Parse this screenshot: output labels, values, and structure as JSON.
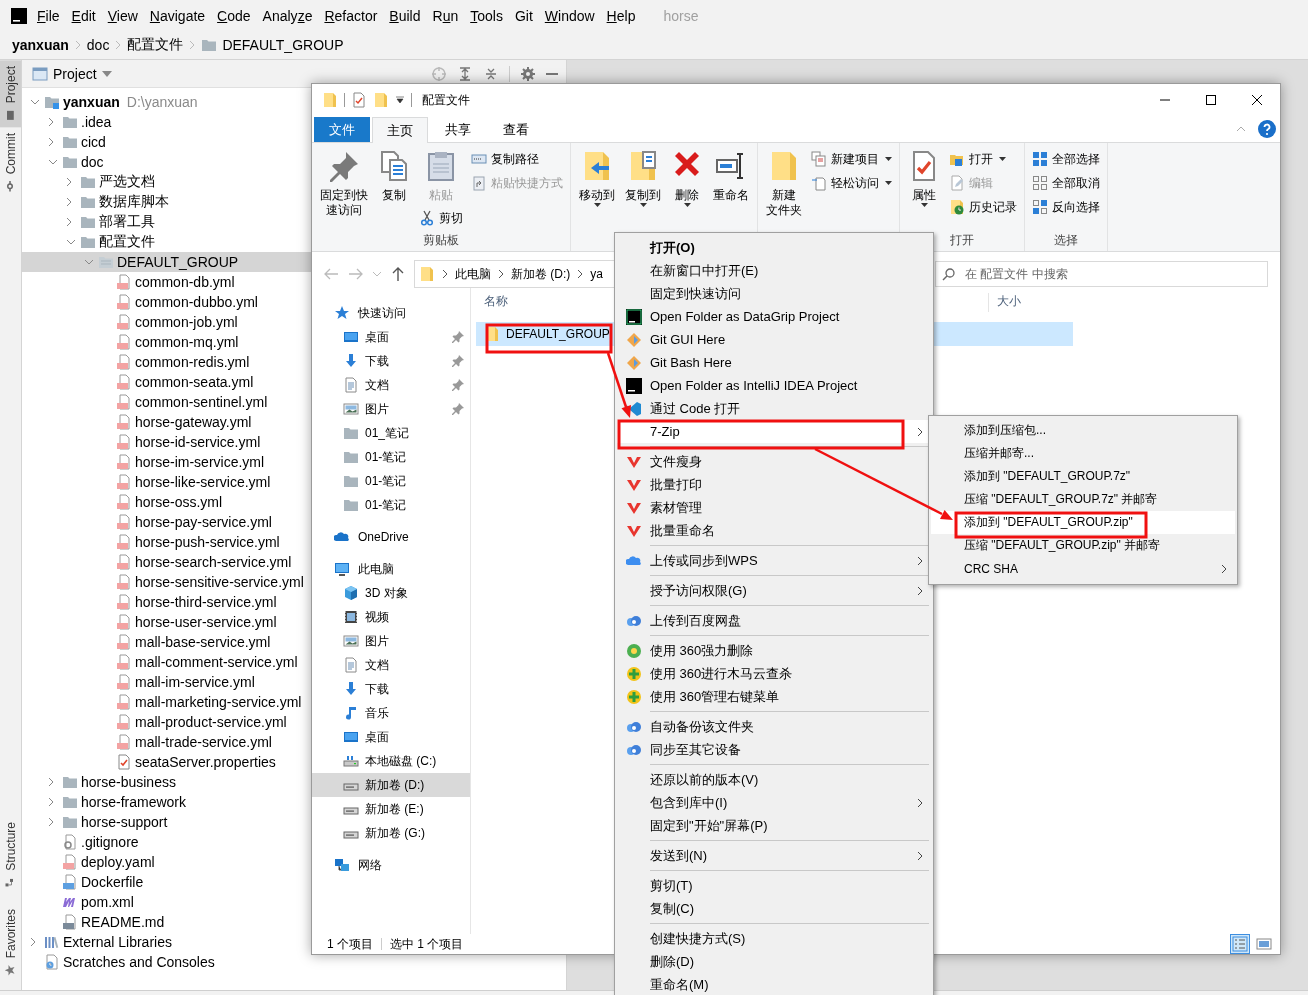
{
  "ide_menu": [
    {
      "key": "F",
      "post": "ile"
    },
    {
      "key": "E",
      "post": "dit"
    },
    {
      "key": "V",
      "post": "iew"
    },
    {
      "key": "N",
      "post": "avigate"
    },
    {
      "key": "C",
      "post": "ode"
    },
    {
      "pre": "Analy",
      "key": "z",
      "post": "e"
    },
    {
      "key": "R",
      "post": "efactor"
    },
    {
      "key": "B",
      "post": "uild"
    },
    {
      "pre": "R",
      "key": "u",
      "post": "n"
    },
    {
      "key": "T",
      "post": "ools"
    },
    {
      "pre": "Git"
    },
    {
      "key": "W",
      "post": "indow"
    },
    {
      "key": "H",
      "post": "elp"
    }
  ],
  "project_title": "horse",
  "breadcrumb": [
    {
      "label": "yanxuan",
      "kind": "root"
    },
    {
      "label": "doc",
      "kind": "plain"
    },
    {
      "label": "配置文件",
      "kind": "plain"
    },
    {
      "label": "DEFAULT_GROUP",
      "kind": "icon"
    }
  ],
  "tool_windows": [
    {
      "label": "Project",
      "kind": "top",
      "selected": true
    },
    {
      "label": "Commit",
      "kind": "top",
      "selected": false
    },
    {
      "label": "Structure",
      "kind": "bottom",
      "selected": false
    },
    {
      "label": "Favorites",
      "kind": "bottom",
      "selected": false
    }
  ],
  "project_panel": {
    "title": "Project",
    "tree": [
      {
        "label": "yanxuan",
        "kind": "module",
        "path": "D:\\yanxuan",
        "expanded": true,
        "selected": false,
        "children": [
          {
            "label": ".idea",
            "kind": "folder",
            "expanded": false,
            "selected": false
          },
          {
            "label": "cicd",
            "kind": "folder",
            "expanded": false,
            "selected": false
          },
          {
            "label": "doc",
            "kind": "folder",
            "expanded": true,
            "selected": false,
            "children": [
              {
                "label": "严选文档",
                "kind": "folder",
                "expanded": false,
                "selected": false
              },
              {
                "label": "数据库脚本",
                "kind": "folder",
                "expanded": false,
                "selected": false
              },
              {
                "label": "部署工具",
                "kind": "folder",
                "expanded": false,
                "selected": false
              },
              {
                "label": "配置文件",
                "kind": "folder",
                "expanded": true,
                "selected": false,
                "children": [
                  {
                    "label": "DEFAULT_GROUP",
                    "kind": "package",
                    "expanded": true,
                    "selected": true,
                    "children": [
                      {
                        "label": "common-db.yml",
                        "kind": "yml",
                        "selected": false
                      },
                      {
                        "label": "common-dubbo.yml",
                        "kind": "yml",
                        "selected": false
                      },
                      {
                        "label": "common-job.yml",
                        "kind": "yml",
                        "selected": false
                      },
                      {
                        "label": "common-mq.yml",
                        "kind": "yml",
                        "selected": false
                      },
                      {
                        "label": "common-redis.yml",
                        "kind": "yml",
                        "selected": false
                      },
                      {
                        "label": "common-seata.yml",
                        "kind": "yml",
                        "selected": false
                      },
                      {
                        "label": "common-sentinel.yml",
                        "kind": "yml",
                        "selected": false
                      },
                      {
                        "label": "horse-gateway.yml",
                        "kind": "yml",
                        "selected": false
                      },
                      {
                        "label": "horse-id-service.yml",
                        "kind": "yml",
                        "selected": false
                      },
                      {
                        "label": "horse-im-service.yml",
                        "kind": "yml",
                        "selected": false
                      },
                      {
                        "label": "horse-like-service.yml",
                        "kind": "yml",
                        "selected": false
                      },
                      {
                        "label": "horse-oss.yml",
                        "kind": "yml",
                        "selected": false
                      },
                      {
                        "label": "horse-pay-service.yml",
                        "kind": "yml",
                        "selected": false
                      },
                      {
                        "label": "horse-push-service.yml",
                        "kind": "yml",
                        "selected": false
                      },
                      {
                        "label": "horse-search-service.yml",
                        "kind": "yml",
                        "selected": false
                      },
                      {
                        "label": "horse-sensitive-service.yml",
                        "kind": "yml",
                        "selected": false
                      },
                      {
                        "label": "horse-third-service.yml",
                        "kind": "yml",
                        "selected": false
                      },
                      {
                        "label": "horse-user-service.yml",
                        "kind": "yml",
                        "selected": false
                      },
                      {
                        "label": "mall-base-service.yml",
                        "kind": "yml",
                        "selected": false
                      },
                      {
                        "label": "mall-comment-service.yml",
                        "kind": "yml",
                        "selected": false
                      },
                      {
                        "label": "mall-im-service.yml",
                        "kind": "yml",
                        "selected": false
                      },
                      {
                        "label": "mall-marketing-service.yml",
                        "kind": "yml",
                        "selected": false
                      },
                      {
                        "label": "mall-product-service.yml",
                        "kind": "yml",
                        "selected": false
                      },
                      {
                        "label": "mall-trade-service.yml",
                        "kind": "yml",
                        "selected": false
                      },
                      {
                        "label": "seataServer.properties",
                        "kind": "properties",
                        "selected": false
                      }
                    ]
                  }
                ]
              }
            ]
          },
          {
            "label": "horse-business",
            "kind": "folder",
            "expanded": false,
            "selected": false
          },
          {
            "label": "horse-framework",
            "kind": "folder",
            "expanded": false,
            "selected": false
          },
          {
            "label": "horse-support",
            "kind": "folder",
            "expanded": false,
            "selected": false
          },
          {
            "label": ".gitignore",
            "kind": "ignore",
            "selected": false
          },
          {
            "label": "deploy.yaml",
            "kind": "yml",
            "selected": false
          },
          {
            "label": "Dockerfile",
            "kind": "docker",
            "selected": false
          },
          {
            "label": "pom.xml",
            "kind": "maven",
            "selected": false
          },
          {
            "label": "README.md",
            "kind": "markdown",
            "selected": false
          }
        ]
      },
      {
        "label": "External Libraries",
        "kind": "libraries",
        "expanded": false,
        "selected": false
      },
      {
        "label": "Scratches and Consoles",
        "kind": "scratches",
        "selected": false
      }
    ]
  },
  "explorer": {
    "title": "配置文件",
    "ribbon_tabs": [
      {
        "label": "文件",
        "kind": "file",
        "selected": false
      },
      {
        "label": "主页",
        "kind": "tab",
        "selected": true
      },
      {
        "label": "共享",
        "kind": "tab",
        "selected": false
      },
      {
        "label": "查看",
        "kind": "tab",
        "selected": false
      }
    ],
    "ribbon_groups": [
      {
        "label": "剪贴板",
        "columns": [
          [
            {
              "lines": [
                "固定到快",
                "速访问"
              ],
              "kind": "large",
              "dropdown": false,
              "disabled": false
            }
          ],
          [
            {
              "label": "复制",
              "kind": "large",
              "dropdown": false,
              "disabled": false
            }
          ],
          [
            {
              "label": "粘贴",
              "kind": "large",
              "dropdown": false,
              "disabled": true
            },
            {
              "label": "剪切",
              "kind": "small",
              "dropdown": false,
              "disabled": false
            }
          ],
          [
            {
              "label": "复制路径",
              "kind": "small",
              "dropdown": false,
              "disabled": false
            },
            {
              "label": "粘贴快捷方式",
              "kind": "small",
              "dropdown": false,
              "disabled": true
            }
          ]
        ]
      },
      {
        "columns": [
          [
            {
              "label": "移动到",
              "kind": "large",
              "dropdown": true,
              "disabled": false
            }
          ],
          [
            {
              "label": "复制到",
              "kind": "large",
              "dropdown": true,
              "disabled": false
            }
          ],
          [
            {
              "label": "删除",
              "kind": "large",
              "dropdown": true,
              "disabled": false
            }
          ],
          [
            {
              "label": "重命名",
              "kind": "large",
              "dropdown": false,
              "disabled": false
            }
          ]
        ]
      },
      {
        "columns": [
          [
            {
              "lines": [
                "新建",
                "文件夹"
              ],
              "kind": "large",
              "dropdown": false,
              "disabled": false
            }
          ],
          [
            {
              "label": "新建项目",
              "kind": "small",
              "dropdown": true,
              "disabled": false
            },
            {
              "label": "轻松访问",
              "kind": "small",
              "dropdown": true,
              "disabled": false
            }
          ]
        ]
      },
      {
        "label": "打开",
        "columns": [
          [
            {
              "label": "属性",
              "kind": "large",
              "dropdown": true,
              "disabled": false
            }
          ],
          [
            {
              "label": "打开",
              "kind": "small",
              "dropdown": true,
              "disabled": false
            },
            {
              "label": "编辑",
              "kind": "small",
              "dropdown": false,
              "disabled": true
            },
            {
              "label": "历史记录",
              "kind": "small",
              "dropdown": false,
              "disabled": false
            }
          ]
        ]
      },
      {
        "label": "选择",
        "columns": [
          [
            {
              "label": "全部选择",
              "kind": "small",
              "dropdown": false,
              "disabled": false
            },
            {
              "label": "全部取消",
              "kind": "small",
              "dropdown": false,
              "disabled": false
            },
            {
              "label": "反向选择",
              "kind": "small",
              "dropdown": false,
              "disabled": false
            }
          ]
        ]
      }
    ],
    "address": [
      "此电脑",
      "新加卷 (D:)",
      "ya"
    ],
    "search": {
      "placeholder": "在 配置文件 中搜索"
    },
    "nav": [
      {
        "label": "快速访问",
        "kind": "star",
        "selected": false,
        "children": [
          {
            "label": "桌面",
            "kind": "desktop",
            "pinned": true,
            "selected": false
          },
          {
            "label": "下载",
            "kind": "download",
            "pinned": true,
            "selected": false
          },
          {
            "label": "文档",
            "kind": "document",
            "pinned": true,
            "selected": false
          },
          {
            "label": "图片",
            "kind": "picture",
            "pinned": true,
            "selected": false
          },
          {
            "label": "01_笔记",
            "kind": "folder",
            "pinned": false,
            "selected": false
          },
          {
            "label": "01-笔记",
            "kind": "folder",
            "pinned": false,
            "selected": false
          },
          {
            "label": "01-笔记",
            "kind": "folder",
            "pinned": false,
            "selected": false
          },
          {
            "label": "01-笔记",
            "kind": "folder",
            "pinned": false,
            "selected": false
          }
        ]
      },
      {
        "label": "OneDrive",
        "kind": "onedrive",
        "selected": false
      },
      {
        "label": "此电脑",
        "kind": "pc",
        "selected": false,
        "children": [
          {
            "label": "3D 对象",
            "kind": "cube",
            "selected": false
          },
          {
            "label": "视频",
            "kind": "video",
            "selected": false
          },
          {
            "label": "图片",
            "kind": "picture",
            "selected": false
          },
          {
            "label": "文档",
            "kind": "document",
            "selected": false
          },
          {
            "label": "下载",
            "kind": "download",
            "selected": false
          },
          {
            "label": "音乐",
            "kind": "music",
            "selected": false
          },
          {
            "label": "桌面",
            "kind": "desktop",
            "selected": false
          },
          {
            "label": "本地磁盘 (C:)",
            "kind": "drive-c",
            "selected": false
          },
          {
            "label": "新加卷 (D:)",
            "kind": "drive",
            "selected": true
          },
          {
            "label": "新加卷 (E:)",
            "kind": "drive",
            "selected": false
          },
          {
            "label": "新加卷 (G:)",
            "kind": "drive",
            "selected": false
          }
        ]
      },
      {
        "label": "网络",
        "kind": "network",
        "selected": false
      }
    ],
    "columns": [
      "名称",
      "大小"
    ],
    "items": [
      {
        "name": "DEFAULT_GROUP",
        "selected": true
      }
    ],
    "status": [
      "1 个项目",
      "选中 1 个项目"
    ],
    "view_modes": [
      {
        "kind": "details",
        "selected": true
      },
      {
        "kind": "large-icons",
        "selected": false
      }
    ]
  },
  "context_menu": {
    "items": [
      {
        "kind": "default",
        "label": "打开(O)",
        "submenu": false,
        "selected": false
      },
      {
        "kind": "plain",
        "label": "在新窗口中打开(E)",
        "submenu": false,
        "selected": false
      },
      {
        "kind": "plain",
        "label": "固定到快速访问",
        "submenu": false,
        "selected": false
      },
      {
        "kind": "datagrip",
        "label": "Open Folder as DataGrip Project",
        "submenu": false,
        "selected": false
      },
      {
        "kind": "git",
        "label": "Git GUI Here",
        "submenu": false,
        "selected": false
      },
      {
        "kind": "git",
        "label": "Git Bash Here",
        "submenu": false,
        "selected": false
      },
      {
        "kind": "idea",
        "label": "Open Folder as IntelliJ IDEA Project",
        "submenu": false,
        "selected": false
      },
      {
        "kind": "vscode",
        "label": "通过 Code 打开",
        "submenu": false,
        "selected": false
      },
      {
        "kind": "plain",
        "label": "7-Zip",
        "submenu": true,
        "selected": true
      },
      {
        "kind": "separator"
      },
      {
        "kind": "wps",
        "label": "文件瘦身",
        "submenu": false,
        "selected": false
      },
      {
        "kind": "wps",
        "label": "批量打印",
        "submenu": false,
        "selected": false
      },
      {
        "kind": "wps",
        "label": "素材管理",
        "submenu": false,
        "selected": false
      },
      {
        "kind": "wps",
        "label": "批量重命名",
        "submenu": false,
        "selected": false
      },
      {
        "kind": "separator"
      },
      {
        "kind": "wps-cloud",
        "label": "上传或同步到WPS",
        "submenu": true,
        "selected": false
      },
      {
        "kind": "separator"
      },
      {
        "kind": "plain",
        "label": "授予访问权限(G)",
        "submenu": true,
        "selected": false
      },
      {
        "kind": "separator"
      },
      {
        "kind": "baidu",
        "label": "上传到百度网盘",
        "submenu": false,
        "selected": false
      },
      {
        "kind": "separator"
      },
      {
        "kind": "shield",
        "label": "使用 360强力删除",
        "submenu": false,
        "selected": false
      },
      {
        "kind": "shield-plus",
        "label": "使用 360进行木马云查杀",
        "submenu": false,
        "selected": false
      },
      {
        "kind": "shield-plus",
        "label": "使用 360管理右键菜单",
        "submenu": false,
        "selected": false
      },
      {
        "kind": "separator"
      },
      {
        "kind": "baidu",
        "label": "自动备份该文件夹",
        "submenu": false,
        "selected": false
      },
      {
        "kind": "baidu",
        "label": "同步至其它设备",
        "submenu": false,
        "selected": false
      },
      {
        "kind": "separator"
      },
      {
        "kind": "plain",
        "label": "还原以前的版本(V)",
        "submenu": false,
        "selected": false
      },
      {
        "kind": "plain",
        "label": "包含到库中(I)",
        "submenu": true,
        "selected": false
      },
      {
        "kind": "plain",
        "label": "固定到\"开始\"屏幕(P)",
        "submenu": false,
        "selected": false
      },
      {
        "kind": "separator"
      },
      {
        "kind": "plain",
        "label": "发送到(N)",
        "submenu": true,
        "selected": false
      },
      {
        "kind": "separator"
      },
      {
        "kind": "plain",
        "label": "剪切(T)",
        "submenu": false,
        "selected": false
      },
      {
        "kind": "plain",
        "label": "复制(C)",
        "submenu": false,
        "selected": false
      },
      {
        "kind": "separator"
      },
      {
        "kind": "plain",
        "label": "创建快捷方式(S)",
        "submenu": false,
        "selected": false
      },
      {
        "kind": "plain",
        "label": "删除(D)",
        "submenu": false,
        "selected": false
      },
      {
        "kind": "plain",
        "label": "重命名(M)",
        "submenu": false,
        "selected": false
      }
    ]
  },
  "submenu": {
    "items": [
      {
        "kind": "plain",
        "label": "添加到压缩包...",
        "submenu": false,
        "selected": false
      },
      {
        "kind": "plain",
        "label": "压缩并邮寄...",
        "submenu": false,
        "selected": false
      },
      {
        "kind": "plain",
        "label": "添加到 \"DEFAULT_GROUP.7z\"",
        "submenu": false,
        "selected": false
      },
      {
        "kind": "plain",
        "label": "压缩 \"DEFAULT_GROUP.7z\" 并邮寄",
        "submenu": false,
        "selected": false
      },
      {
        "kind": "plain",
        "label": "添加到 \"DEFAULT_GROUP.zip\"",
        "submenu": false,
        "selected": true
      },
      {
        "kind": "plain",
        "label": "压缩 \"DEFAULT_GROUP.zip\" 并邮寄",
        "submenu": false,
        "selected": false
      },
      {
        "kind": "plain",
        "label": "CRC SHA",
        "submenu": true,
        "selected": false
      }
    ]
  }
}
